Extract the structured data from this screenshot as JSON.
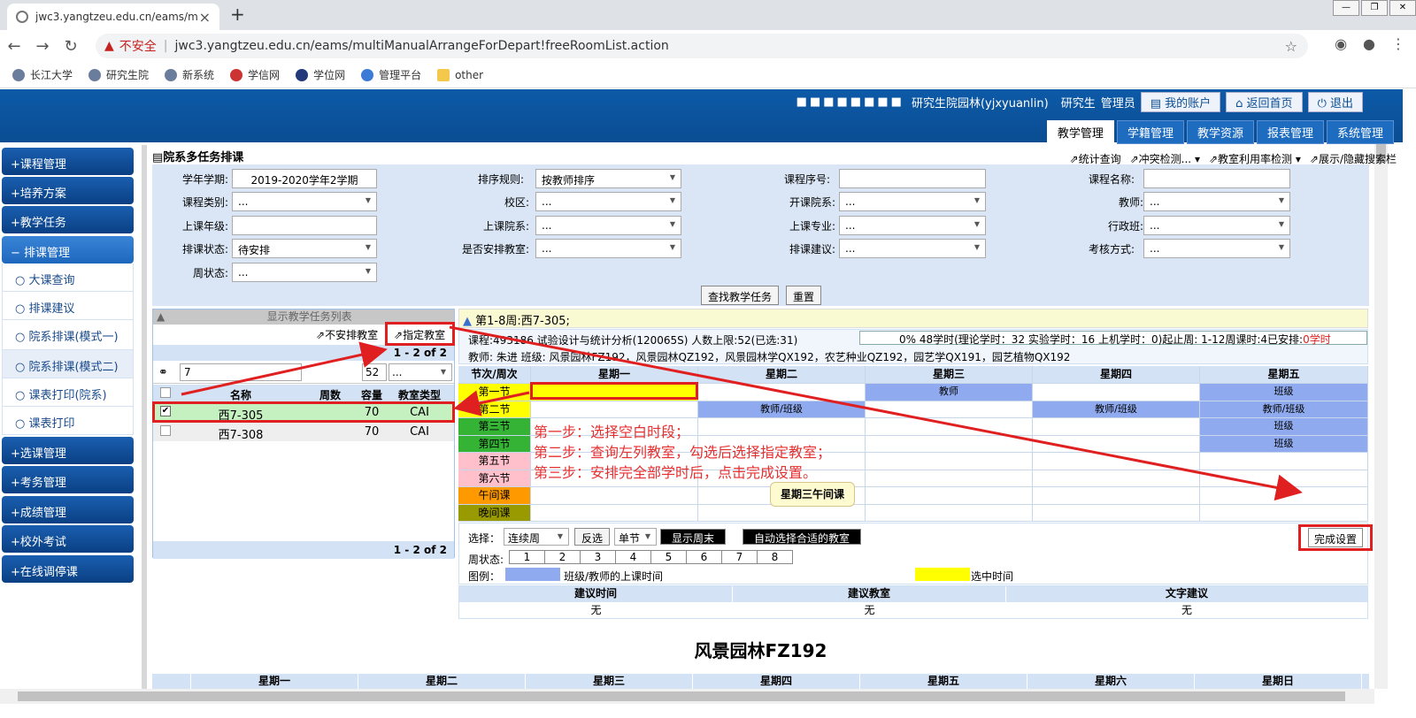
{
  "browser": {
    "tab_title": "jwc3.yangtzeu.edu.cn/eams/m",
    "insecure": "不安全",
    "url": "jwc3.yangtzeu.edu.cn/eams/multiManualArrangeForDepart!freeRoomList.action",
    "bookmarks": [
      "长江大学",
      "研究生院",
      "新系统",
      "学信网",
      "学位网",
      "管理平台",
      "other"
    ]
  },
  "header": {
    "user": "研究生院园林(yjxyuanlin)",
    "role1": "研究生",
    "role2": "管理员",
    "account": "我的账户",
    "home": "返回首页",
    "logout": "退出",
    "nav": [
      "教学管理",
      "学籍管理",
      "教学资源",
      "报表管理",
      "系统管理"
    ]
  },
  "sidebar": {
    "groups": [
      "课程管理",
      "培养方案",
      "教学任务",
      "排课管理",
      "选课管理",
      "考务管理",
      "成绩管理",
      "校外考试",
      "在线调停课"
    ],
    "items": [
      "大课查询",
      "排课建议",
      "院系排课(模式一)",
      "院系排课(模式二)",
      "课表打印(院系)",
      "课表打印"
    ]
  },
  "page": {
    "title": "院系多任务排课",
    "tools": [
      "统计查询",
      "冲突检测...",
      "教室利用率检测",
      "展示/隐藏搜索栏"
    ]
  },
  "form": {
    "labels": {
      "term": "学年学期:",
      "order": "排序规则:",
      "course_no": "课程序号:",
      "course_name": "课程名称:",
      "course_type": "课程类别:",
      "campus": "校区:",
      "dept": "开课院系:",
      "teacher": "教师:",
      "grade": "上课年级:",
      "class_dept": "上课院系:",
      "major": "上课专业:",
      "admin_class": "行政班:",
      "status": "排课状态:",
      "arranged": "是否安排教室:",
      "suggest": "排课建议:",
      "exam": "考核方式:",
      "week_status": "周状态:"
    },
    "values": {
      "term": "2019-2020学年2学期",
      "order": "按教师排序",
      "status": "待安排",
      "dots": "..."
    },
    "search": "查找教学任务",
    "reset": "重置"
  },
  "left": {
    "header": "显示教学任务列表",
    "no_room": "不安排教室",
    "assign": "指定教室",
    "pager": "1 - 2 of 2",
    "filter_value": "7",
    "cap_value": "52",
    "filter_dots": "...",
    "columns": [
      "名称",
      "周数",
      "容量",
      "教室类型"
    ],
    "rows": [
      {
        "name": "西7-305",
        "weeks": "",
        "cap": "70",
        "type": "CAI"
      },
      {
        "name": "西7-308",
        "weeks": "",
        "cap": "70",
        "type": "CAI"
      }
    ]
  },
  "schedule": {
    "week_title": "第1-8周:西7-305;",
    "course_line": "课程:493186 试验设计与统计分析(120065S) 人数上限:52(已选:31)",
    "hours_line": "0% 48学时(理论学时：32 实验学时：16 上机学时：0)起止周: 1-12周课时:4已安排:",
    "arranged": "0学时",
    "teacher_line": "教师: 朱进 班级: 风景园林FZ192，风景园林QZ192，风景园林学QX192，农艺种业QZ192，园艺学QX191，园艺植物QX192",
    "header": [
      "节次/周次",
      "星期一",
      "星期二",
      "星期三",
      "星期四",
      "星期五"
    ],
    "periods": [
      "第一节",
      "第二节",
      "第三节",
      "第四节",
      "第五节",
      "第六节",
      "午间课",
      "晚间课"
    ],
    "cells": {
      "teacher": "教师",
      "class": "班级",
      "tc": "教师/班级"
    },
    "notes": [
      "第一步：选择空白时段；",
      "第二步：查询左列教室，勾选后选择指定教室；",
      "第三步：安排完全部学时后，点击完成设置。"
    ],
    "tooltip": "星期三午间课",
    "select_label": "选择：",
    "cont_week": "连续周",
    "invert": "反选",
    "single": "单节",
    "show_weekend": "显示周末",
    "auto": "自动选择合适的教室",
    "done": "完成设置",
    "week_status": "周状态:",
    "weeks": [
      "1",
      "2",
      "3",
      "4",
      "5",
      "6",
      "7",
      "8"
    ],
    "legend": "图例：",
    "legend1": "班级/教师的上课时间",
    "legend2": "选中时间",
    "sug_cols": [
      "建议时间",
      "建议教室",
      "文字建议"
    ],
    "sug_vals": [
      "无",
      "无",
      "无"
    ]
  },
  "bottom": {
    "title": "风景园林FZ192",
    "days": [
      "星期一",
      "星期二",
      "星期三",
      "星期四",
      "星期五",
      "星期六",
      "星期日"
    ]
  },
  "colors": {
    "blue_cell": "#8faaee",
    "yellow": "#ffff00",
    "green": "#34b334",
    "pink": "#ffc0cb",
    "orange": "#ff9900",
    "olive": "#999900",
    "red": "#e02020"
  }
}
